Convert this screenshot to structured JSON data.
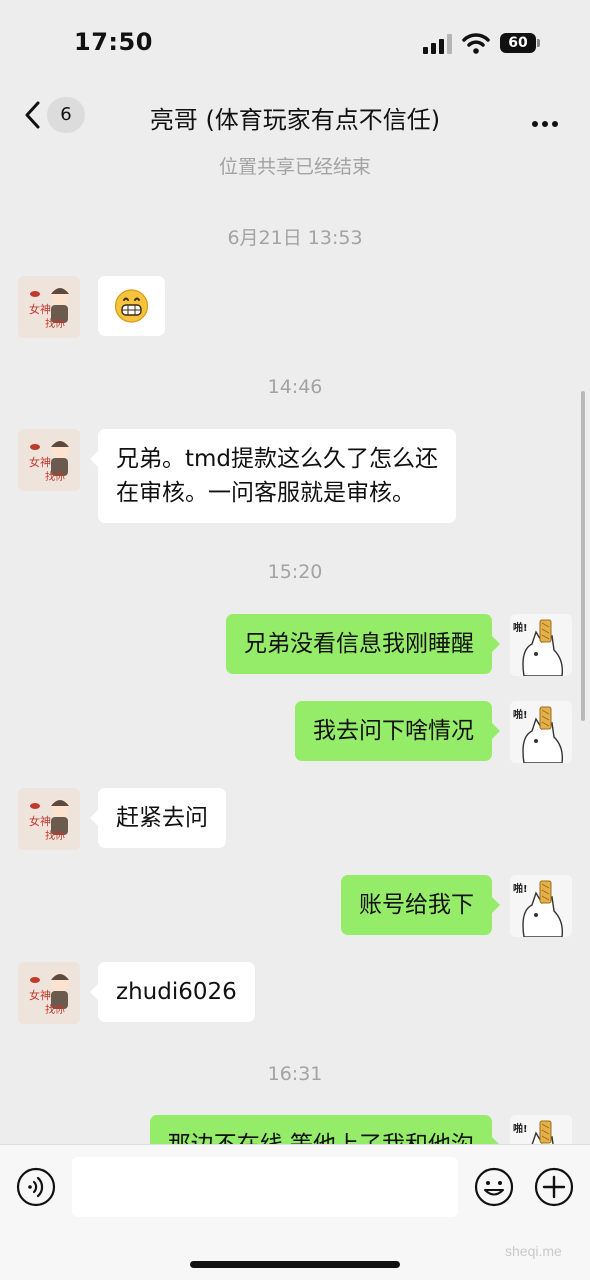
{
  "status_bar": {
    "time": "17:50",
    "battery": "60"
  },
  "nav": {
    "unread_count": "6",
    "title": "亮哥 (体育玩家有点不信任)"
  },
  "chat": {
    "system_notice": "位置共享已经结束",
    "timestamps": [
      "6月21日 13:53",
      "14:46",
      "15:20",
      "16:31"
    ],
    "messages": [
      {
        "side": "left",
        "type": "emoji",
        "icon": "grinning-face-icon"
      },
      {
        "side": "left",
        "type": "text",
        "lines": [
          "兄弟。tmd提款这么久了怎么还",
          "在审核。一问客服就是审核。"
        ]
      },
      {
        "side": "right",
        "type": "text",
        "text": "兄弟没看信息我刚睡醒"
      },
      {
        "side": "right",
        "type": "text",
        "text": "我去问下啥情况"
      },
      {
        "side": "left",
        "type": "text",
        "text": "赶紧去问"
      },
      {
        "side": "right",
        "type": "text",
        "text": "账号给我下"
      },
      {
        "side": "left",
        "type": "text",
        "text": "zhudi6026"
      },
      {
        "side": "right",
        "type": "text",
        "text": "那边不在线 等他上了我和他沟"
      }
    ]
  },
  "input": {
    "placeholder": ""
  },
  "watermark": "sheqi.me",
  "colors": {
    "background": "#ededed",
    "sent_bubble": "#95ec69",
    "received_bubble": "#ffffff",
    "meta_text": "#a3a3a3"
  }
}
